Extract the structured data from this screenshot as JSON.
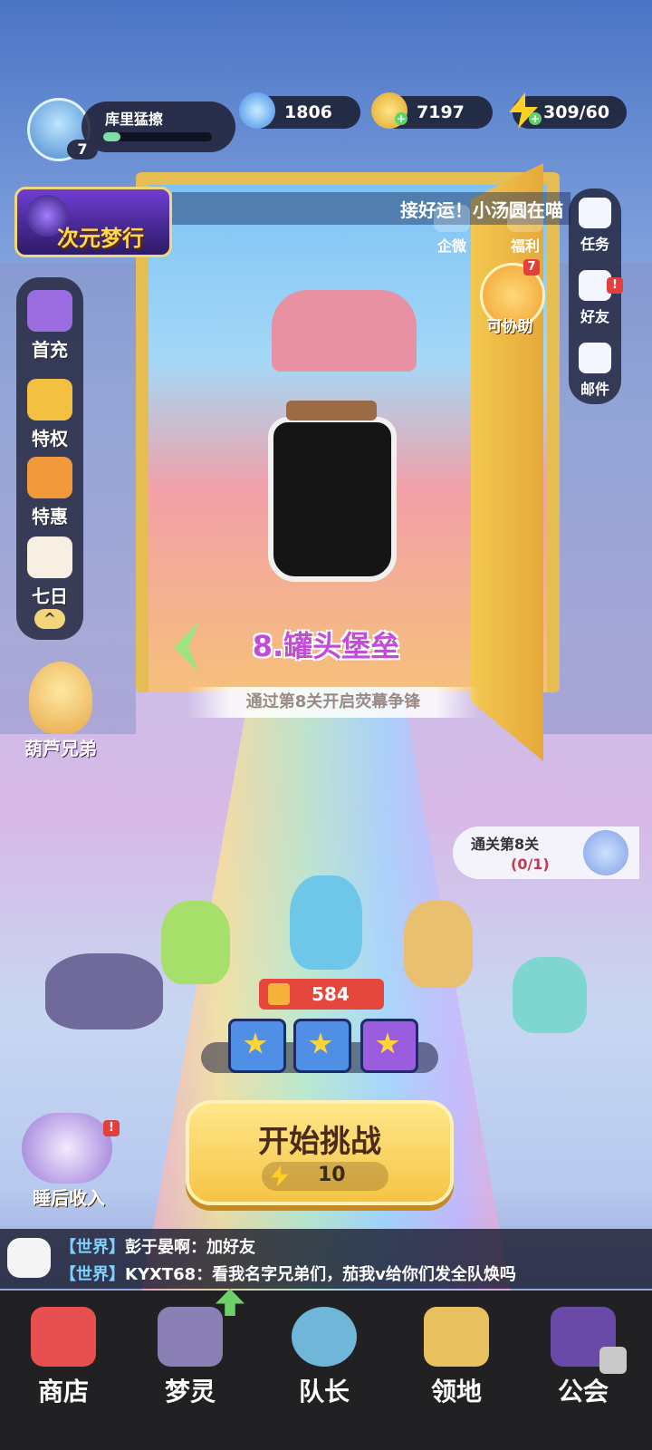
{
  "player": {
    "name": "库里猛擦",
    "level": "7",
    "exp_fraction": 0.16
  },
  "resources": {
    "gems": "1806",
    "gold": "7197",
    "energy": "309/60"
  },
  "event_banner": {
    "label": "次元梦行"
  },
  "ticker": {
    "text": "接好运！小汤圆在喵"
  },
  "top_links": [
    {
      "label": "企微"
    },
    {
      "label": "福利"
    }
  ],
  "right_menu": [
    {
      "label": "任务"
    },
    {
      "label": "好友",
      "badge": "!"
    },
    {
      "label": "邮件"
    }
  ],
  "assist": {
    "label": "可协助",
    "badge": "7"
  },
  "left_menu": [
    {
      "label": "首充"
    },
    {
      "label": "特权"
    },
    {
      "label": "特惠"
    },
    {
      "label": "七日"
    }
  ],
  "gourd": {
    "label": "葫芦兄弟"
  },
  "stage": {
    "title": "8.罐头堡垒",
    "hint": "通过第8关开启荧幕争锋"
  },
  "quest": {
    "title": "通关第8关",
    "progress": "(0/1)"
  },
  "team": {
    "power": "584"
  },
  "start": {
    "label": "开始挑战",
    "cost": "10"
  },
  "sleep": {
    "label": "睡后收入",
    "badge": "!"
  },
  "chat": [
    {
      "channel": "【世界】",
      "text": "彭于晏啊：加好友"
    },
    {
      "channel": "【世界】",
      "text": "KYXT68：看我名字兄弟们，茄我v给你们发全队焕吗"
    }
  ],
  "bottom_nav": [
    {
      "label": "商店"
    },
    {
      "label": "梦灵"
    },
    {
      "label": "队长"
    },
    {
      "label": "领地"
    },
    {
      "label": "公会"
    }
  ],
  "colors": {
    "accent_yellow": "#f5c445",
    "stage_purple": "#c24bd8",
    "nav_bg": "#212124"
  }
}
